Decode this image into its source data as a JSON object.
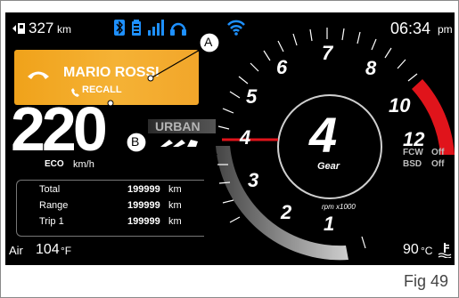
{
  "status_bar": {
    "range_value": "327",
    "range_unit": "km",
    "time": "06:34",
    "time_suffix": "pm"
  },
  "call": {
    "caller": "MARIO ROSSI",
    "status": "RECALL"
  },
  "callouts": {
    "a": "A",
    "b": "B"
  },
  "speed": {
    "value": "220",
    "mode": "ECO",
    "unit": "km/h"
  },
  "ride_mode": "URBAN",
  "odometer": {
    "rows": [
      {
        "label": "Total",
        "value": "199999",
        "unit": "km"
      },
      {
        "label": "Range",
        "value": "199999",
        "unit": "km"
      },
      {
        "label": "Trip 1",
        "value": "199999",
        "unit": "km"
      }
    ]
  },
  "air": {
    "label": "Air",
    "value": "104",
    "unit": "°F"
  },
  "engine_temp": {
    "value": "90",
    "unit": "°C"
  },
  "gauge": {
    "gear": "4",
    "gear_label": "Gear",
    "rpm_label": "rpm x1000",
    "ticks": [
      "1",
      "2",
      "3",
      "4",
      "5",
      "6",
      "7",
      "8",
      "10",
      "12"
    ]
  },
  "assist": [
    {
      "label": "FCW",
      "value": "Off"
    },
    {
      "label": "BSD",
      "value": "Off"
    }
  ],
  "figure_label": "Fig 49",
  "colors": {
    "accent_orange": "#f5ad2a",
    "redline": "#e0141b",
    "status_blue": "#1e90ff"
  }
}
